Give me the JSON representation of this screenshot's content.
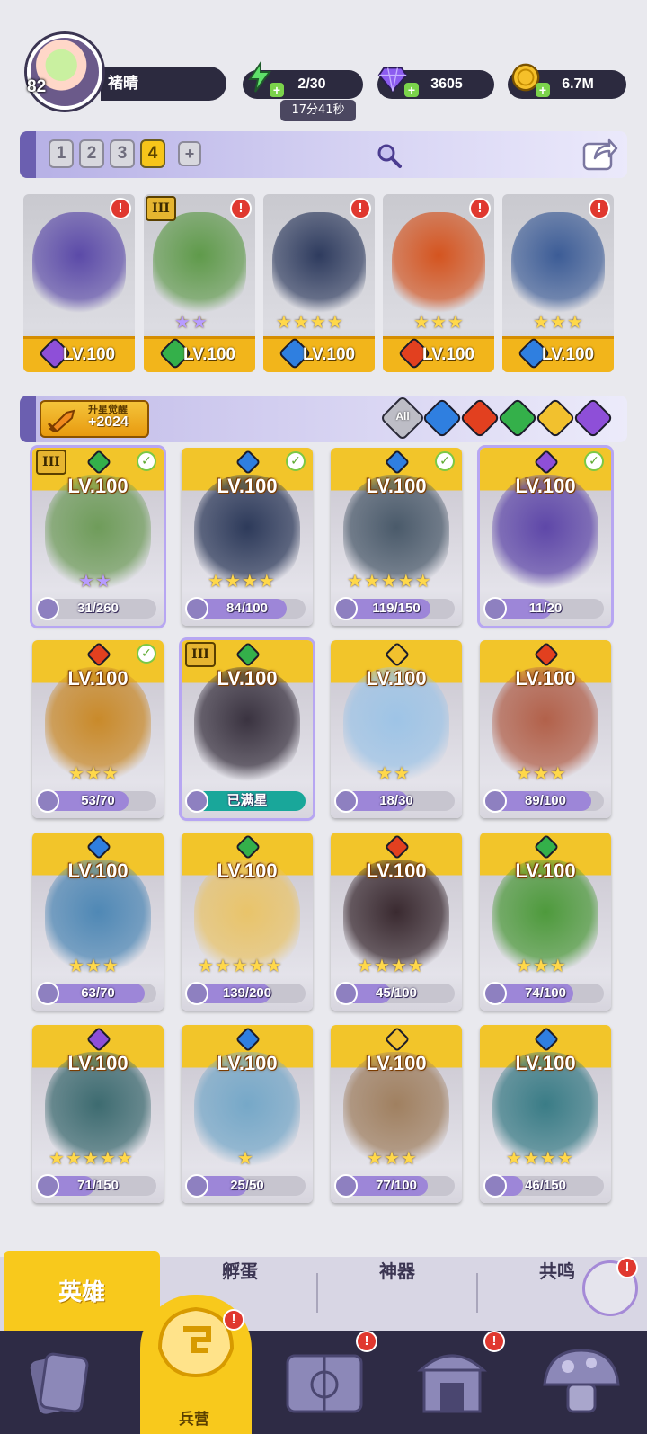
{
  "player": {
    "level": "82",
    "name": "褚晴"
  },
  "resources": {
    "energy": "2/30",
    "energy_timer": "17分41秒",
    "gems": "3605",
    "gold": "6.7M"
  },
  "teams": {
    "tabs": [
      "1",
      "2",
      "3",
      "4",
      "+"
    ],
    "active_index": 3
  },
  "lineup": [
    {
      "element": "dark",
      "level": "LV.100",
      "stars": 0,
      "star_type": "",
      "tier": false,
      "color": "#5b4aa8"
    },
    {
      "element": "nature",
      "level": "LV.100",
      "stars": 2,
      "star_type": "purple",
      "tier": true,
      "tier_label": "III",
      "color": "#5f9a4a"
    },
    {
      "element": "water",
      "level": "LV.100",
      "stars": 4,
      "star_type": "gold",
      "tier": false,
      "color": "#2e3b5e"
    },
    {
      "element": "fire",
      "level": "LV.100",
      "stars": 3,
      "star_type": "gold",
      "tier": false,
      "color": "#d4541f"
    },
    {
      "element": "water",
      "level": "LV.100",
      "stars": 3,
      "star_type": "gold",
      "tier": false,
      "color": "#3c5c96"
    }
  ],
  "lineup_alert": "!",
  "awaken": {
    "label": "升星觉醒",
    "value": "+2024"
  },
  "filters": {
    "all_label": "All",
    "elements": [
      "water",
      "fire",
      "nature",
      "light",
      "dark"
    ]
  },
  "element_colors": {
    "water": "#2f7fe0",
    "fire": "#e2401f",
    "nature": "#34b04a",
    "light": "#f2c12e",
    "dark": "#8e4fd8"
  },
  "heroes": [
    {
      "level": "LV.100",
      "element": "nature",
      "progress": "31/260",
      "fraction": 0.12,
      "stars": 2,
      "star_type": "purple",
      "tier": "III",
      "check": true,
      "color": "#6f9c5a",
      "highlight": true
    },
    {
      "level": "LV.100",
      "element": "water",
      "progress": "84/100",
      "fraction": 0.84,
      "stars": 4,
      "star_type": "gold",
      "tier": "",
      "check": true,
      "color": "#2d3a5a",
      "highlight": false
    },
    {
      "level": "LV.100",
      "element": "water",
      "progress": "119/150",
      "fraction": 0.79,
      "stars": 5,
      "star_type": "gold",
      "tier": "",
      "check": true,
      "color": "#4a5a6a",
      "highlight": false
    },
    {
      "level": "LV.100",
      "element": "dark",
      "progress": "11/20",
      "fraction": 0.55,
      "stars": 0,
      "star_type": "",
      "tier": "",
      "check": true,
      "color": "#5e47a8",
      "highlight": true
    },
    {
      "level": "LV.100",
      "element": "fire",
      "progress": "53/70",
      "fraction": 0.76,
      "stars": 3,
      "star_type": "gold",
      "tier": "",
      "check": true,
      "color": "#c98a2a",
      "highlight": false
    },
    {
      "level": "LV.100",
      "element": "nature",
      "progress": "已满星",
      "fraction": 1,
      "stars": 0,
      "star_type": "",
      "tier": "III",
      "check": false,
      "color": "#3a3340",
      "highlight": true,
      "maxed": true
    },
    {
      "level": "LV.100",
      "element": "light",
      "progress": "18/30",
      "fraction": 0.6,
      "stars": 2,
      "star_type": "gold",
      "tier": "",
      "check": false,
      "color": "#9ec4e6",
      "highlight": false
    },
    {
      "level": "LV.100",
      "element": "fire",
      "progress": "89/100",
      "fraction": 0.89,
      "stars": 3,
      "star_type": "gold",
      "tier": "",
      "check": false,
      "color": "#b2614a",
      "highlight": false
    },
    {
      "level": "LV.100",
      "element": "water",
      "progress": "63/70",
      "fraction": 0.9,
      "stars": 3,
      "star_type": "gold",
      "tier": "",
      "check": false,
      "color": "#4f88b5",
      "highlight": false
    },
    {
      "level": "LV.100",
      "element": "nature",
      "progress": "139/200",
      "fraction": 0.7,
      "stars": 5,
      "star_type": "gold",
      "tier": "",
      "check": false,
      "color": "#e9c46a",
      "highlight": false
    },
    {
      "level": "LV.100",
      "element": "fire",
      "progress": "45/100",
      "fraction": 0.45,
      "stars": 4,
      "star_type": "gold",
      "tier": "",
      "check": false,
      "color": "#3a2a30",
      "highlight": false
    },
    {
      "level": "LV.100",
      "element": "nature",
      "progress": "74/100",
      "fraction": 0.74,
      "stars": 3,
      "star_type": "gold",
      "tier": "",
      "check": false,
      "color": "#4e9a3c",
      "highlight": false
    },
    {
      "level": "LV.100",
      "element": "dark",
      "progress": "71/150",
      "fraction": 0.47,
      "stars": 5,
      "star_type": "gold",
      "tier": "",
      "check": false,
      "color": "#3d6b70",
      "highlight": false
    },
    {
      "level": "LV.100",
      "element": "water",
      "progress": "25/50",
      "fraction": 0.5,
      "stars": 1,
      "star_type": "gold",
      "tier": "",
      "check": false,
      "color": "#76a8c8",
      "highlight": false
    },
    {
      "level": "LV.100",
      "element": "light",
      "progress": "77/100",
      "fraction": 0.77,
      "stars": 3,
      "star_type": "gold",
      "tier": "",
      "check": false,
      "color": "#a08060",
      "highlight": false
    },
    {
      "level": "LV.100",
      "element": "water",
      "progress": "46/150",
      "fraction": 0.31,
      "stars": 4,
      "star_type": "gold",
      "tier": "",
      "check": false,
      "color": "#3a7c86",
      "highlight": false
    }
  ],
  "subtabs": [
    "英雄",
    "孵蛋",
    "神器",
    "共鸣"
  ],
  "nav": {
    "active_label": "兵营",
    "items": [
      "cards-icon",
      "barracks-icon",
      "book-icon",
      "temple-icon",
      "mushroom-icon"
    ]
  }
}
